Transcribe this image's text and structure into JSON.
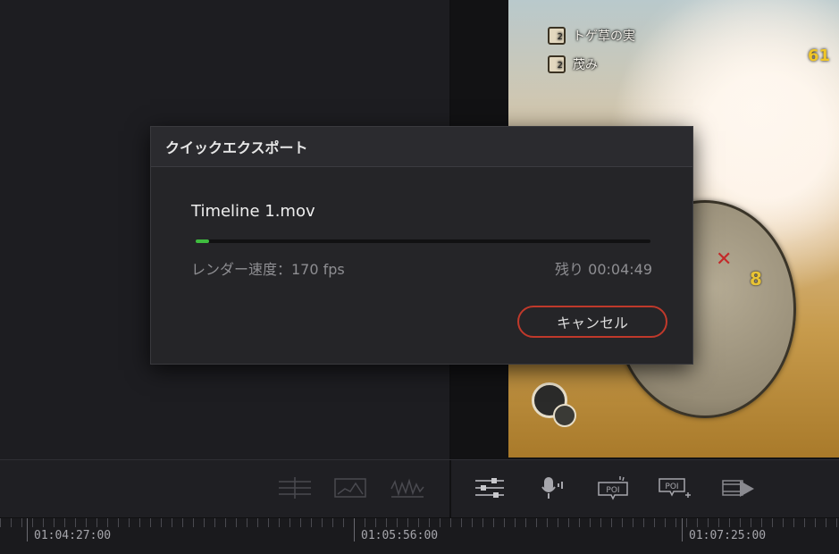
{
  "dialog": {
    "title": "クイックエクスポート",
    "filename": "Timeline 1.mov",
    "progress_fraction": 0.03,
    "render_speed": "レンダー速度：170 fps",
    "time_remaining": "残り 00:04:49",
    "cancel_label": "キャンセル"
  },
  "viewer": {
    "hud_items": [
      {
        "label": "トゲ草の実",
        "count": "2"
      },
      {
        "label": "茂み",
        "count": "2"
      }
    ],
    "hud_number": "61",
    "minimap_number": "8"
  },
  "toolbar": {
    "left_icons": [
      "split-view-icon",
      "video-scope-icon",
      "waveform-icon"
    ],
    "right_icons": [
      "mixer-sliders-icon",
      "voiceover-mic-icon",
      "poi-marker-icon",
      "poi-add-icon",
      "render-play-icon"
    ]
  },
  "timeline": {
    "timecodes": [
      "01:04:27:00",
      "01:05:56:00",
      "01:07:25:00"
    ]
  },
  "colors": {
    "progress": "#3fbd3f",
    "cancel_border": "#c0392b",
    "background": "#1c1c1f"
  }
}
